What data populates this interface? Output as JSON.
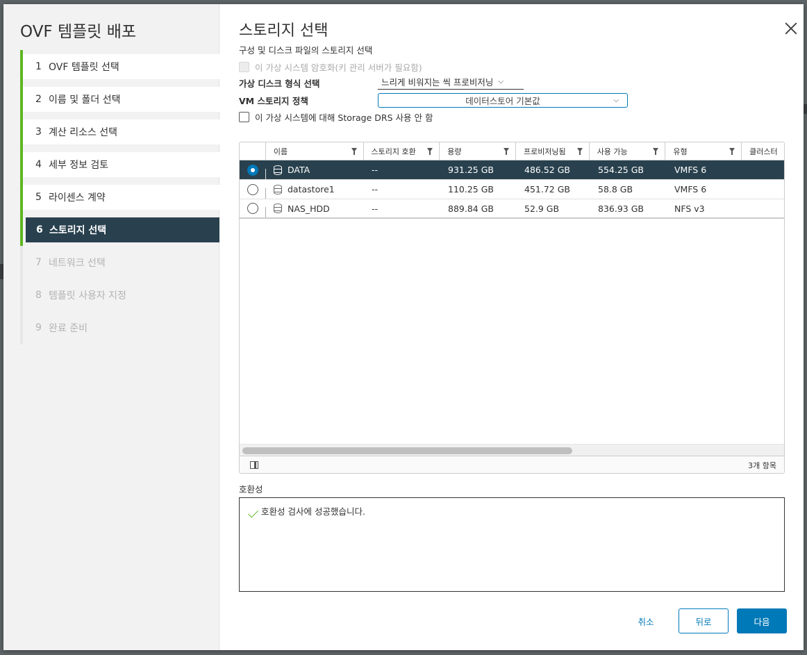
{
  "sidebar": {
    "title": "OVF 템플릿 배포",
    "steps": [
      {
        "num": "1",
        "label": "OVF 템플릿 선택"
      },
      {
        "num": "2",
        "label": "이름 및 폴더 선택"
      },
      {
        "num": "3",
        "label": "계산 리소스 선택"
      },
      {
        "num": "4",
        "label": "세부 정보 검토"
      },
      {
        "num": "5",
        "label": "라이센스 계약"
      },
      {
        "num": "6",
        "label": "스토리지 선택"
      },
      {
        "num": "7",
        "label": "네트워크 선택"
      },
      {
        "num": "8",
        "label": "템플릿 사용자 지정"
      },
      {
        "num": "9",
        "label": "완료 준비"
      }
    ]
  },
  "main": {
    "title": "스토리지 선택",
    "subtitle": "구성 및 디스크 파일의 스토리지 선택",
    "encrypt_label": "이 가상 시스템 암호화(키 관리 서버가 필요함)",
    "disk_format_label": "가상 디스크 형식 선택",
    "disk_format_value": "느리게 비워지는 씩 프로비저닝",
    "policy_label": "VM 스토리지 정책",
    "policy_value": "데이터스토어 기본값",
    "drs_label": "이 가상 시스템에 대해 Storage DRS 사용 안 함"
  },
  "grid": {
    "columns": [
      "이름",
      "스토리지 호환",
      "용량",
      "프로비저닝됨",
      "사용 가능",
      "유형",
      "클러스터"
    ],
    "rows": [
      {
        "name": "DATA",
        "compat": "--",
        "capacity": "931.25 GB",
        "provisioned": "486.52 GB",
        "free": "554.25 GB",
        "type": "VMFS 6",
        "selected": true
      },
      {
        "name": "datastore1",
        "compat": "--",
        "capacity": "110.25 GB",
        "provisioned": "451.72 GB",
        "free": "58.8 GB",
        "type": "VMFS 6",
        "selected": false
      },
      {
        "name": "NAS_HDD",
        "compat": "--",
        "capacity": "889.84 GB",
        "provisioned": "52.9 GB",
        "free": "836.93 GB",
        "type": "NFS v3",
        "selected": false
      }
    ],
    "count": "3개 항목"
  },
  "compat": {
    "label": "호환성",
    "message": "호환성 검사에 성공했습니다."
  },
  "buttons": {
    "cancel": "취소",
    "back": "뒤로",
    "next": "다음"
  },
  "colors": {
    "accent": "#0079b8",
    "selected_row": "#29414e",
    "success": "#5eb623"
  }
}
